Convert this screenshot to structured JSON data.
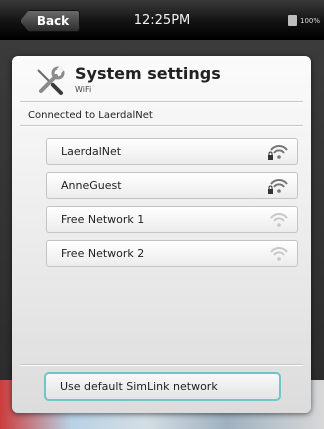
{
  "statusbar": {
    "back_label": "Back",
    "time": "12:25PM",
    "battery": "100%"
  },
  "header": {
    "title": "System settings",
    "subtitle": "WiFi",
    "icon": "wrench-screwdriver-icon"
  },
  "connection_status": "Connected to LaerdalNet",
  "networks": [
    {
      "name": "LaerdalNet",
      "locked": true,
      "signal": "strong"
    },
    {
      "name": "AnneGuest",
      "locked": true,
      "signal": "strong"
    },
    {
      "name": "Free Network 1",
      "locked": false,
      "signal": "weak"
    },
    {
      "name": "Free Network 2",
      "locked": false,
      "signal": "weak"
    }
  ],
  "default_button": "Use default SimLink network",
  "colors": {
    "accent_border": "#6ec6c9",
    "signal_strong": "#777777",
    "signal_weak": "#c8c8c8"
  }
}
